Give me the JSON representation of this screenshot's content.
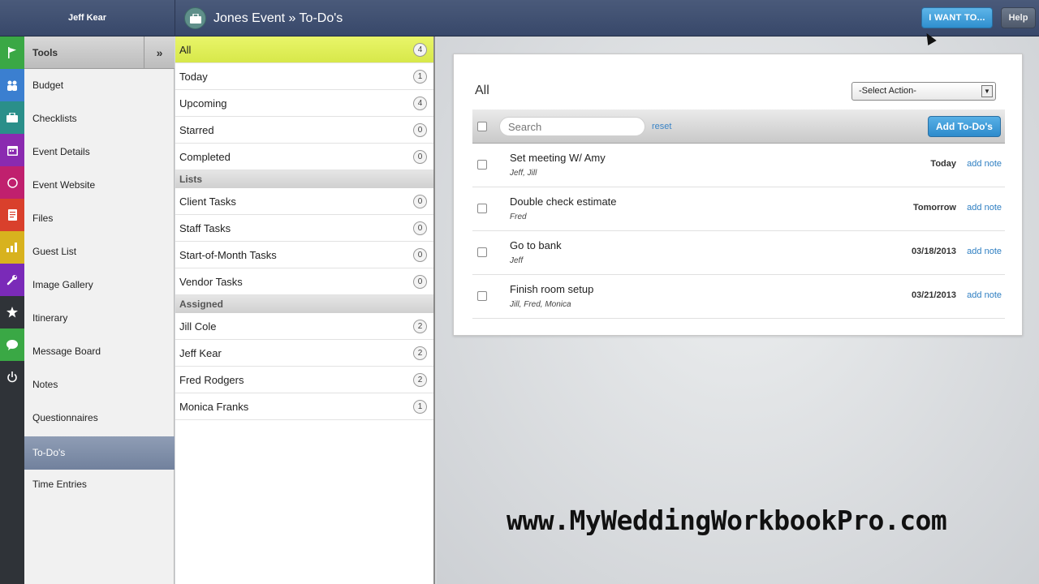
{
  "header": {
    "user_name": "Jeff Kear",
    "page_title": "Jones Event » To-Do's",
    "i_want_label": "I WANT TO...",
    "help_label": "Help"
  },
  "rail_icons": [
    "flag-icon",
    "people-icon",
    "briefcase-icon",
    "calendar-icon",
    "compass-icon",
    "document-icon",
    "bar-chart-icon",
    "wrench-icon",
    "star-icon",
    "chat-icon",
    "power-icon"
  ],
  "sidebar": {
    "header_label": "Tools",
    "collapse_label": "»",
    "items": [
      {
        "label": "Budget"
      },
      {
        "label": "Checklists"
      },
      {
        "label": "Event Details"
      },
      {
        "label": "Event Website"
      },
      {
        "label": "Files"
      },
      {
        "label": "Guest List"
      },
      {
        "label": "Image Gallery"
      },
      {
        "label": "Itinerary"
      },
      {
        "label": "Message Board"
      },
      {
        "label": "Notes"
      },
      {
        "label": "Questionnaires"
      },
      {
        "label": "To-Do's"
      },
      {
        "label": "Time Entries"
      }
    ],
    "active_item": "To-Do's"
  },
  "filters": {
    "views": [
      {
        "label": "All",
        "count": "4"
      },
      {
        "label": "Today",
        "count": "1"
      },
      {
        "label": "Upcoming",
        "count": "4"
      },
      {
        "label": "Starred",
        "count": "0"
      },
      {
        "label": "Completed",
        "count": "0"
      }
    ],
    "lists_header": "Lists",
    "lists": [
      {
        "label": "Client Tasks",
        "count": "0"
      },
      {
        "label": "Staff Tasks",
        "count": "0"
      },
      {
        "label": "Start-of-Month Tasks",
        "count": "0"
      },
      {
        "label": "Vendor Tasks",
        "count": "0"
      }
    ],
    "assigned_header": "Assigned",
    "assigned": [
      {
        "label": "Jill Cole",
        "count": "2"
      },
      {
        "label": "Jeff Kear",
        "count": "2"
      },
      {
        "label": "Fred Rodgers",
        "count": "2"
      },
      {
        "label": "Monica Franks",
        "count": "1"
      }
    ]
  },
  "main": {
    "title": "All",
    "select_action": "-Select Action-",
    "search_placeholder": "Search",
    "reset_label": "reset",
    "add_button": "Add To-Do's",
    "todos": [
      {
        "title": "Set meeting W/ Amy",
        "assignees": "Jeff, Jill",
        "due": "Today",
        "note_link": "add note"
      },
      {
        "title": "Double check estimate",
        "assignees": "Fred",
        "due": "Tomorrow",
        "note_link": "add note"
      },
      {
        "title": "Go to bank",
        "assignees": "Jeff",
        "due": "03/18/2013",
        "note_link": "add note"
      },
      {
        "title": "Finish room setup",
        "assignees": "Jill, Fred, Monica",
        "due": "03/21/2013",
        "note_link": "add note"
      }
    ]
  },
  "watermark": "www.MyWeddingWorkbookPro.com",
  "colors": {
    "topbar": "#3f4f70",
    "selected_filter": "#e2f05c",
    "active_sidebar": "#8190aa",
    "primary_button": "#3a9ad8",
    "link": "#2f7fc2"
  }
}
